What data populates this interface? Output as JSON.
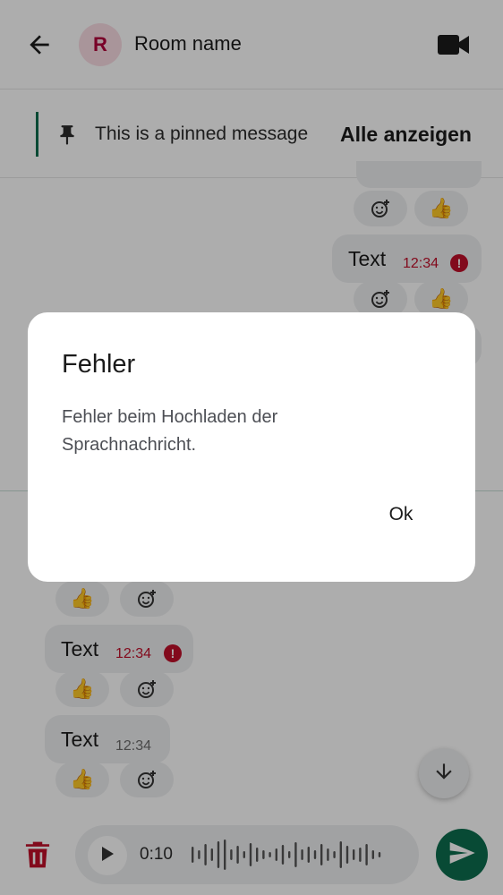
{
  "header": {
    "avatar_letter": "R",
    "room_name": "Room name"
  },
  "pinned": {
    "text": "This is a pinned message",
    "action": "Alle anzeigen"
  },
  "messages": [
    {
      "text": "Text",
      "time": "12:34",
      "failed": true,
      "side": "right"
    },
    {
      "text": "Text",
      "time": "12:34",
      "failed": true,
      "side": "left"
    },
    {
      "text": "Text",
      "time": "12:34",
      "failed": false,
      "side": "left"
    }
  ],
  "reaction": {
    "emoji": "👍"
  },
  "composer": {
    "duration": "0:10"
  },
  "dialog": {
    "title": "Fehler",
    "body": "Fehler beim Hochladen der Sprachnachricht.",
    "ok_label": "Ok"
  },
  "colors": {
    "accent": "#0d6e4f",
    "error": "#c0102a",
    "bubble": "#eeeff1"
  }
}
